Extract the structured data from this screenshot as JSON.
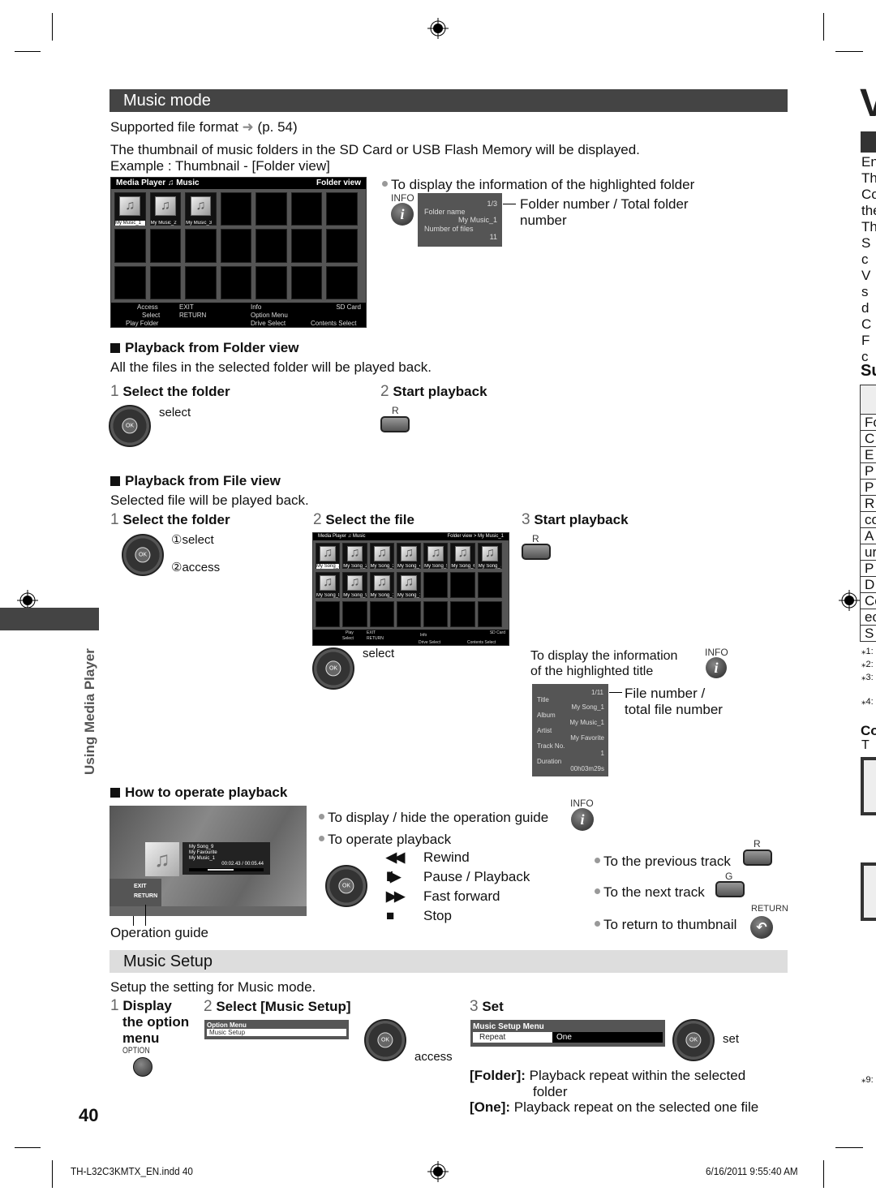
{
  "page_number": "40",
  "side_label": "Using Media Player",
  "footer": {
    "file": "TH-L32C3KMTX_EN.indd   40",
    "timestamp": "6/16/2011   9:55:40 AM"
  },
  "music_mode": {
    "title": "Music mode",
    "supported": "Supported file format",
    "supported_ref": "(p. 54)",
    "intro_1": "The thumbnail of music folders in the SD Card or USB Flash Memory will be displayed.",
    "intro_2": "Example : Thumbnail - [Folder view]",
    "folder_screen": {
      "header_left": "Media Player",
      "header_mode": "Music",
      "header_right": "Folder view",
      "folders": [
        "My Music_1",
        "My Music_2",
        "My Music_3"
      ],
      "foot": {
        "access": "Access",
        "select": "Select",
        "exit": "EXIT",
        "return": "RETURN",
        "info": "Info",
        "option": "Option Menu",
        "sd": "SD Card",
        "play_folder": "Play Folder",
        "drive": "Drive Select",
        "contents": "Contents Select"
      }
    },
    "folder_info": {
      "bullet": "To display the information of the highlighted folder",
      "info_label": "INFO",
      "count": "1/3",
      "folder_name_label": "Folder name",
      "folder_name": "My Music_1",
      "files_label": "Number of files",
      "files": "11",
      "callout_1": "Folder number / Total folder",
      "callout_2": "number"
    },
    "folder_view": {
      "heading": "Playback from Folder view",
      "desc": "All the files in the selected folder will be played back.",
      "step1_num": "1",
      "step1": "Select the folder",
      "step1_hint": "select",
      "step2_num": "2",
      "step2": "Start playback",
      "step2_key": "R"
    },
    "file_view": {
      "heading": "Playback from File view",
      "desc": "Selected file will be played back.",
      "step1_num": "1",
      "step1": "Select the folder",
      "step1_hint_1": "①select",
      "step1_hint_2": "②access",
      "step2_num": "2",
      "step2": "Select the file",
      "step2_hint": "select",
      "step3_num": "3",
      "step3": "Start playback",
      "step3_key": "R",
      "file_screen": {
        "header_left": "Media Player",
        "header_mode": "Music",
        "header_right": "Folder view > My Music_1",
        "files": [
          "My Song_1",
          "My Song_2",
          "My Song_3",
          "My Song_4",
          "My Song_5",
          "My Song_6",
          "My Song_7",
          "My Song_8",
          "My Song_9",
          "My Song_10",
          "My Song_11"
        ],
        "foot": {
          "play": "Play",
          "select": "Select",
          "exit": "EXIT",
          "return": "RETURN",
          "info": "Info",
          "sd": "SD Card",
          "drive": "Drive Select",
          "contents": "Contents Select"
        }
      },
      "title_info": {
        "text_1": "To display the information",
        "text_2": "of the highlighted title",
        "info_label": "INFO",
        "count": "1/11",
        "rows": [
          {
            "label": "Title",
            "value": "My Song_1"
          },
          {
            "label": "Album",
            "value": "My Music_1"
          },
          {
            "label": "Artist",
            "value": "My Favorite"
          },
          {
            "label": "Track No.",
            "value": "1"
          },
          {
            "label": "Duration",
            "value": "00h03m29s"
          }
        ],
        "callout_1": "File number /",
        "callout_2": "total file number"
      }
    },
    "operate": {
      "heading": "How to operate playback",
      "player": {
        "song": "My Song_9",
        "artist": "My Favourite",
        "album": "My Music_1",
        "time": "00:02.43 / 00:05.44",
        "exit": "EXIT",
        "return": "RETURN"
      },
      "guide_caption": "Operation guide",
      "bullet_guide": "To display / hide the operation guide",
      "info_label": "INFO",
      "bullet_operate": "To operate playback",
      "controls": [
        {
          "glyph": "◀◀",
          "label": "Rewind"
        },
        {
          "glyph": "II/▶",
          "label": "Pause / Playback"
        },
        {
          "glyph": "▶▶",
          "label": "Fast forward"
        },
        {
          "glyph": "■",
          "label": "Stop"
        }
      ],
      "prev": "To the previous track",
      "prev_key": "R",
      "next": "To the next track",
      "next_key": "G",
      "back": "To return to thumbnail",
      "back_key": "RETURN"
    }
  },
  "music_setup": {
    "title": "Music Setup",
    "desc": "Setup the setting for Music mode.",
    "step1_num": "1",
    "step1_a": "Display",
    "step1_b": "the option",
    "step1_c": "menu",
    "option_key": "OPTION",
    "step2_num": "2",
    "step2": "Select [Music Setup]",
    "option_menu_title": "Option Menu",
    "option_menu_item": "Music Setup",
    "access": "access",
    "step3_num": "3",
    "step3": "Set",
    "setup_menu_title": "Music Setup Menu",
    "setup_item": "Repeat",
    "setup_value": "One",
    "set": "set",
    "folder_term": "[Folder]:",
    "folder_desc_1": "Playback repeat within the selected",
    "folder_desc_2": "folder",
    "one_term": "[One]:",
    "one_desc": "Playback repeat on the selected one file"
  },
  "right_margin": {
    "letters": [
      "En",
      "Th",
      "Co",
      "the",
      "Th",
      "S",
      "c",
      "V",
      "s",
      "d",
      "C",
      "F",
      "c"
    ],
    "su": "Su",
    "table": [
      "Fo",
      "C",
      "E",
      "P",
      "P",
      "R",
      "co",
      "A",
      "ur",
      "P",
      "D",
      "Co",
      "ec",
      "S"
    ],
    "notes": [
      "⁎1:",
      "⁎2:",
      "⁎3:",
      "⁎4:",
      "⁎9:"
    ],
    "co": "Co",
    "t": "T"
  }
}
